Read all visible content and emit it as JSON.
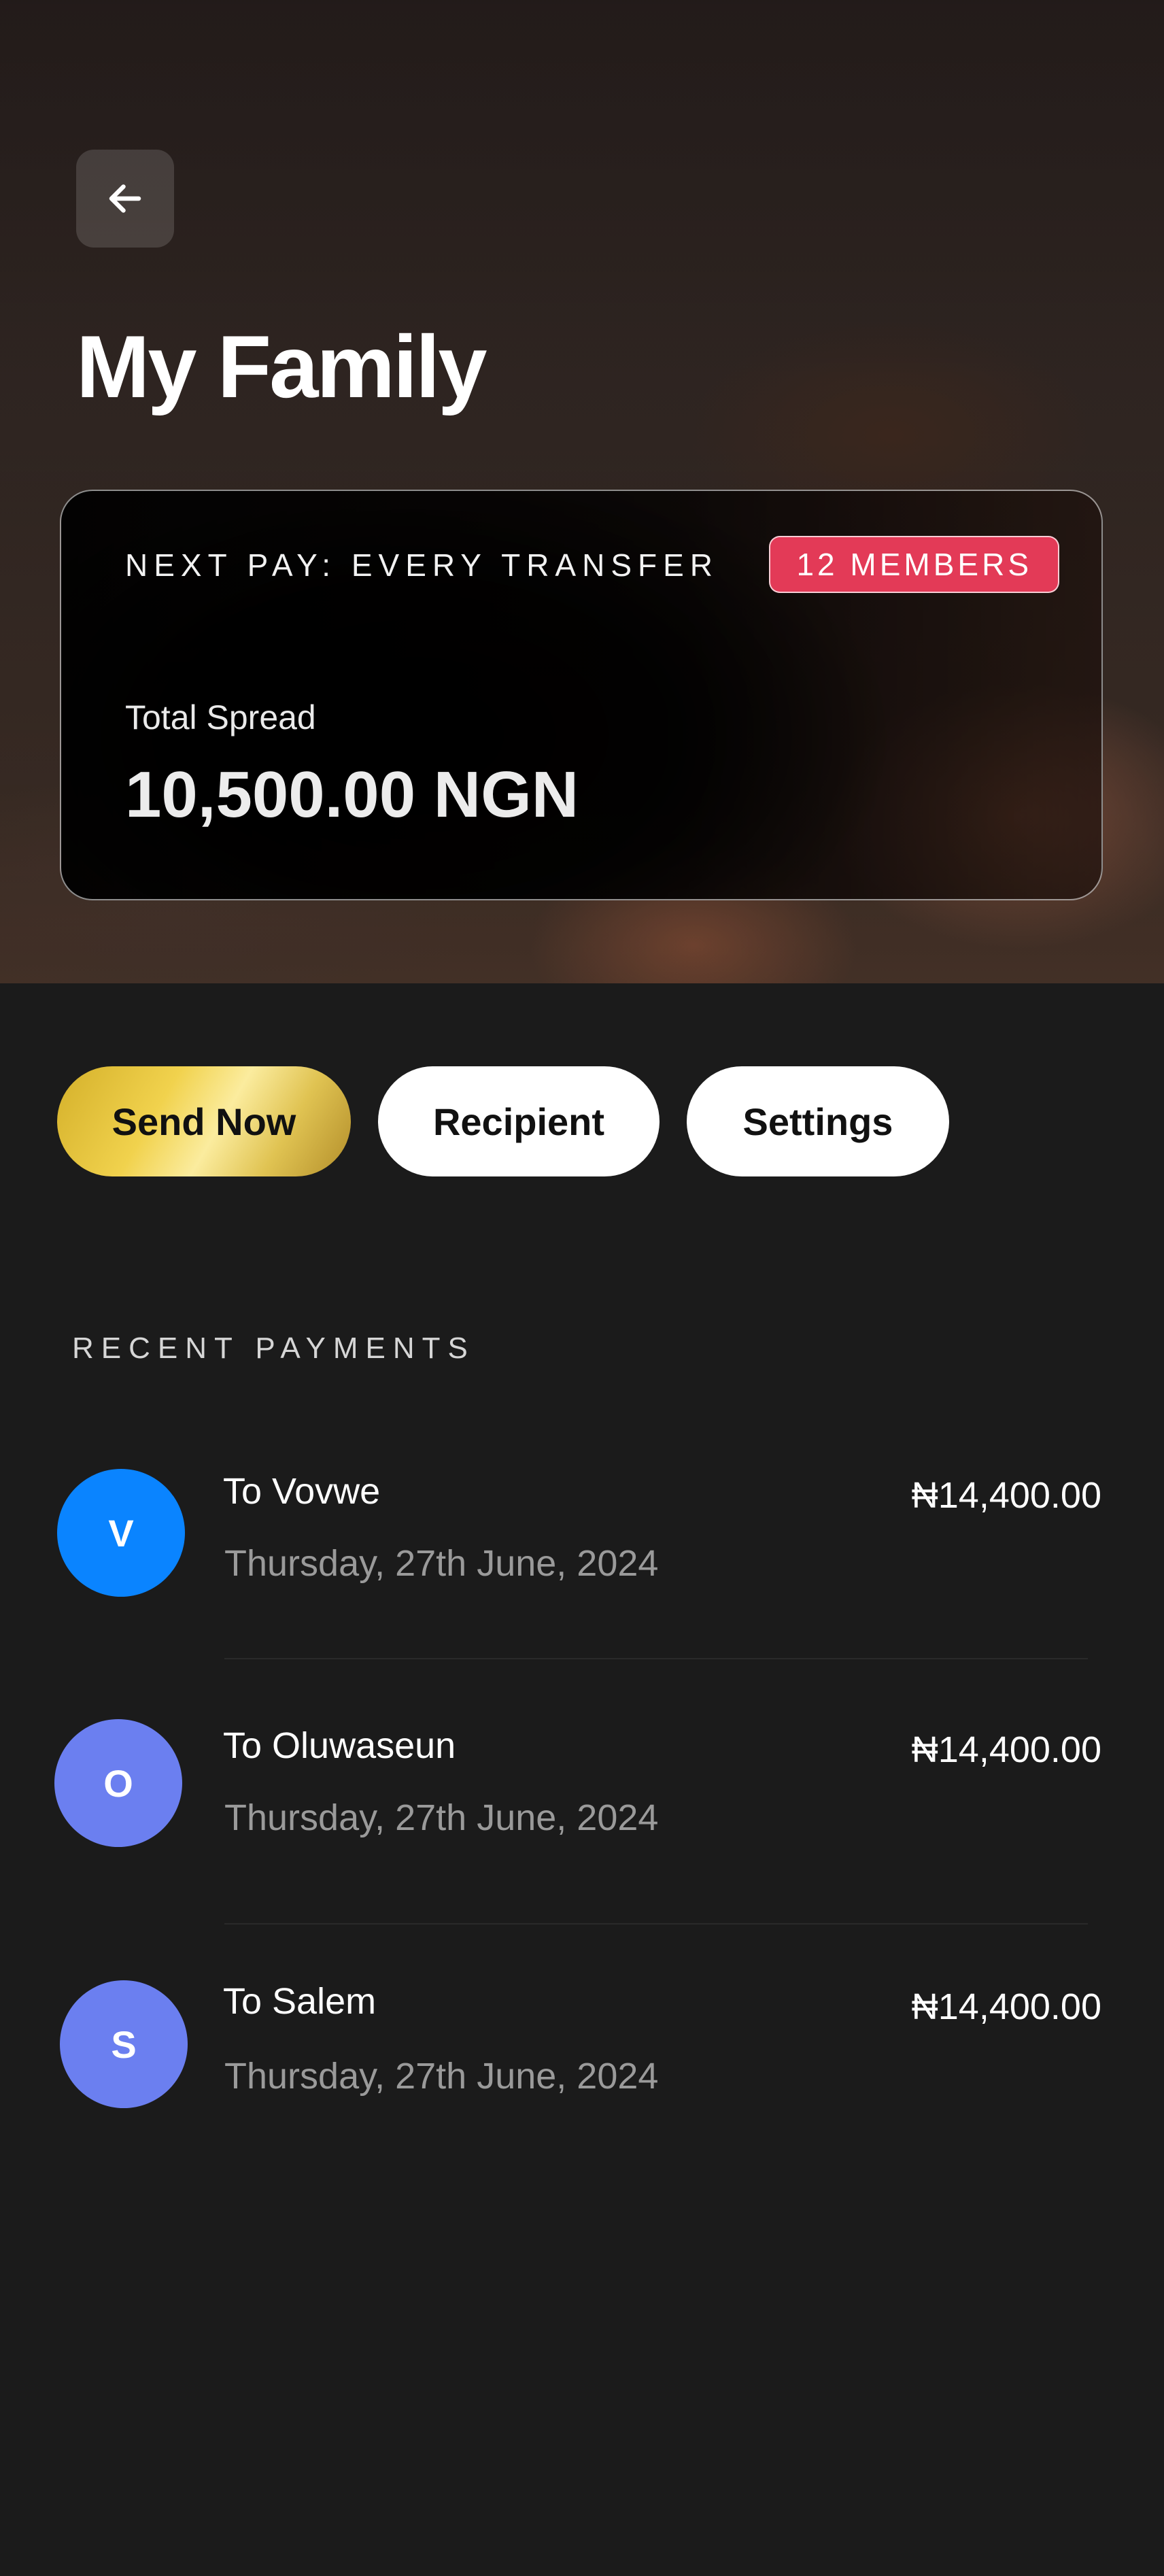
{
  "header": {
    "back_icon": "arrow-left-icon",
    "title": "My Family"
  },
  "card": {
    "label": "NEXT PAY: EVERY TRANSFER",
    "members_badge": "12 MEMBERS",
    "spread_label": "Total Spread",
    "spread_value": "10,500.00 NGN",
    "badge_color": "#e33a57"
  },
  "actions": {
    "send_now": "Send Now",
    "recipient": "Recipient",
    "settings": "Settings"
  },
  "recent": {
    "title": "RECENT PAYMENTS",
    "items": [
      {
        "initial": "V",
        "name": "To Vovwe",
        "date": "Thursday, 27th June, 2024",
        "amount": "₦14,400.00",
        "avatar_color": "#0a84ff"
      },
      {
        "initial": "O",
        "name": "To Oluwaseun",
        "date": "Thursday, 27th June, 2024",
        "amount": "₦14,400.00",
        "avatar_color": "#6b7ff0"
      },
      {
        "initial": "S",
        "name": "To Salem",
        "date": "Thursday, 27th June, 2024",
        "amount": "₦14,400.00",
        "avatar_color": "#6b7ff0"
      }
    ]
  }
}
